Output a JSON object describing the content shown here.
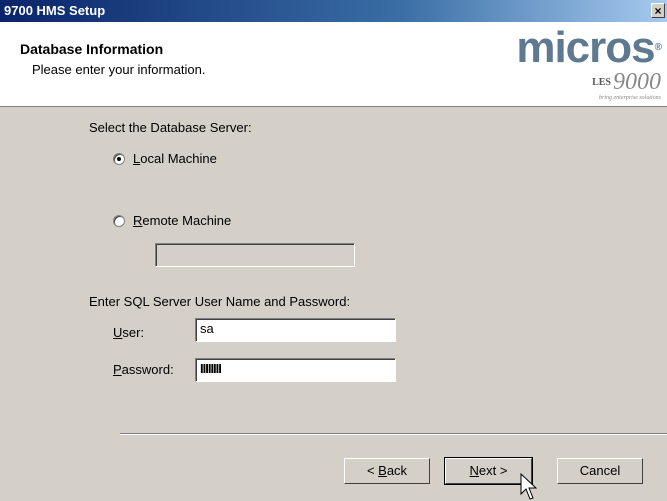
{
  "window": {
    "title": "9700 HMS Setup",
    "close_glyph": "×"
  },
  "header": {
    "title": "Database Information",
    "subtitle": "Please enter your information.",
    "logo": {
      "brand": "micros",
      "reg": "®",
      "les": "LES",
      "version": "9000",
      "tagline": "bring enterprise solutions"
    }
  },
  "server": {
    "label": "Select the Database Server:",
    "options": [
      {
        "accel": "L",
        "rest": "ocal Machine",
        "selected": true
      },
      {
        "accel": "R",
        "rest": "emote Machine",
        "selected": false
      }
    ],
    "remote_value": ""
  },
  "credentials": {
    "label": "Enter SQL Server User Name and Password:",
    "user_accel": "U",
    "user_rest": "ser:",
    "user_value": "sa",
    "password_accel": "P",
    "password_rest": "assword:",
    "password_value": "IIIIIIII"
  },
  "buttons": {
    "back_pre": "< ",
    "back_accel": "B",
    "back_rest": "ack",
    "next_accel": "N",
    "next_rest": "ext >",
    "cancel": "Cancel"
  },
  "icons": {
    "close": "close-icon",
    "cursor": "arrow-cursor-icon",
    "radio": "radio-icon"
  }
}
